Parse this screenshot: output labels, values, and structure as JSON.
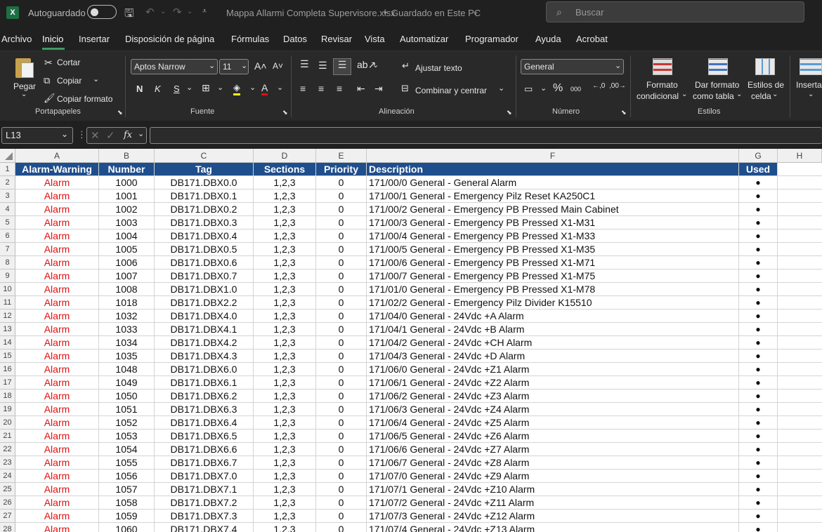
{
  "titlebar": {
    "autosave_label": "Autoguardado",
    "doc_title": "Mappa Allarmi Completa Supervisore.xlsx",
    "save_status": "Guardado en Este PC",
    "search_placeholder": "Buscar"
  },
  "menu": [
    "Archivo",
    "Inicio",
    "Insertar",
    "Disposición de página",
    "Fórmulas",
    "Datos",
    "Revisar",
    "Vista",
    "Automatizar",
    "Programador",
    "Ayuda",
    "Acrobat"
  ],
  "ribbon": {
    "clipboard": {
      "paste": "Pegar",
      "cut": "Cortar",
      "copy": "Copiar",
      "format_painter": "Copiar formato",
      "group": "Portapapeles"
    },
    "font": {
      "name": "Aptos Narrow",
      "size": "11",
      "bold": "N",
      "italic": "K",
      "underline": "S",
      "group": "Fuente"
    },
    "alignment": {
      "wrap": "Ajustar texto",
      "merge": "Combinar y centrar",
      "group": "Alineación"
    },
    "number": {
      "format": "General",
      "percent": "%",
      "thousands": "000",
      "group": "Número"
    },
    "styles": {
      "conditional": "Formato",
      "conditional2": "condicional",
      "as_table": "Dar formato",
      "as_table2": "como tabla",
      "cell_styles": "Estilos de",
      "cell_styles2": "celda",
      "group": "Estilos"
    },
    "cells": {
      "insert": "Inserta"
    }
  },
  "formula": {
    "name_box": "L13",
    "fx": "fx",
    "value": ""
  },
  "columns": [
    {
      "letter": "A"
    },
    {
      "letter": "B"
    },
    {
      "letter": "C"
    },
    {
      "letter": "D"
    },
    {
      "letter": "E"
    },
    {
      "letter": "F"
    },
    {
      "letter": "G"
    },
    {
      "letter": "H"
    }
  ],
  "table_header": [
    "Alarm-Warning",
    "Number",
    "Tag",
    "Sections",
    "Priority",
    "Description",
    "Used"
  ],
  "rows": [
    [
      "Alarm",
      "1000",
      "DB171.DBX0.0",
      "1,2,3",
      "0",
      "171/00/0 General - General Alarm",
      "●"
    ],
    [
      "Alarm",
      "1001",
      "DB171.DBX0.1",
      "1,2,3",
      "0",
      "171/00/1 General - Emergency Pilz Reset KA250C1",
      "●"
    ],
    [
      "Alarm",
      "1002",
      "DB171.DBX0.2",
      "1,2,3",
      "0",
      "171/00/2 General - Emergency PB Pressed Main Cabinet",
      "●"
    ],
    [
      "Alarm",
      "1003",
      "DB171.DBX0.3",
      "1,2,3",
      "0",
      "171/00/3 General - Emergency PB Pressed X1-M31",
      "●"
    ],
    [
      "Alarm",
      "1004",
      "DB171.DBX0.4",
      "1,2,3",
      "0",
      "171/00/4 General - Emergency PB Pressed X1-M33",
      "●"
    ],
    [
      "Alarm",
      "1005",
      "DB171.DBX0.5",
      "1,2,3",
      "0",
      "171/00/5 General - Emergency PB Pressed X1-M35",
      "●"
    ],
    [
      "Alarm",
      "1006",
      "DB171.DBX0.6",
      "1,2,3",
      "0",
      "171/00/6 General - Emergency PB Pressed X1-M71",
      "●"
    ],
    [
      "Alarm",
      "1007",
      "DB171.DBX0.7",
      "1,2,3",
      "0",
      "171/00/7 General - Emergency PB Pressed X1-M75",
      "●"
    ],
    [
      "Alarm",
      "1008",
      "DB171.DBX1.0",
      "1,2,3",
      "0",
      "171/01/0 General - Emergency PB Pressed X1-M78",
      "●"
    ],
    [
      "Alarm",
      "1018",
      "DB171.DBX2.2",
      "1,2,3",
      "0",
      "171/02/2 General - Emergency Pilz Divider K15510",
      "●"
    ],
    [
      "Alarm",
      "1032",
      "DB171.DBX4.0",
      "1,2,3",
      "0",
      "171/04/0 General - 24Vdc +A Alarm",
      "●"
    ],
    [
      "Alarm",
      "1033",
      "DB171.DBX4.1",
      "1,2,3",
      "0",
      "171/04/1 General - 24Vdc +B Alarm",
      "●"
    ],
    [
      "Alarm",
      "1034",
      "DB171.DBX4.2",
      "1,2,3",
      "0",
      "171/04/2 General - 24Vdc +CH Alarm",
      "●"
    ],
    [
      "Alarm",
      "1035",
      "DB171.DBX4.3",
      "1,2,3",
      "0",
      "171/04/3 General - 24Vdc +D Alarm",
      "●"
    ],
    [
      "Alarm",
      "1048",
      "DB171.DBX6.0",
      "1,2,3",
      "0",
      "171/06/0 General - 24Vdc +Z1 Alarm",
      "●"
    ],
    [
      "Alarm",
      "1049",
      "DB171.DBX6.1",
      "1,2,3",
      "0",
      "171/06/1 General - 24Vdc +Z2 Alarm",
      "●"
    ],
    [
      "Alarm",
      "1050",
      "DB171.DBX6.2",
      "1,2,3",
      "0",
      "171/06/2 General - 24Vdc +Z3 Alarm",
      "●"
    ],
    [
      "Alarm",
      "1051",
      "DB171.DBX6.3",
      "1,2,3",
      "0",
      "171/06/3 General - 24Vdc +Z4 Alarm",
      "●"
    ],
    [
      "Alarm",
      "1052",
      "DB171.DBX6.4",
      "1,2,3",
      "0",
      "171/06/4 General - 24Vdc +Z5 Alarm",
      "●"
    ],
    [
      "Alarm",
      "1053",
      "DB171.DBX6.5",
      "1,2,3",
      "0",
      "171/06/5 General - 24Vdc +Z6 Alarm",
      "●"
    ],
    [
      "Alarm",
      "1054",
      "DB171.DBX6.6",
      "1,2,3",
      "0",
      "171/06/6 General - 24Vdc +Z7 Alarm",
      "●"
    ],
    [
      "Alarm",
      "1055",
      "DB171.DBX6.7",
      "1,2,3",
      "0",
      "171/06/7 General - 24Vdc +Z8 Alarm",
      "●"
    ],
    [
      "Alarm",
      "1056",
      "DB171.DBX7.0",
      "1,2,3",
      "0",
      "171/07/0 General - 24Vdc +Z9 Alarm",
      "●"
    ],
    [
      "Alarm",
      "1057",
      "DB171.DBX7.1",
      "1,2,3",
      "0",
      "171/07/1 General - 24Vdc +Z10 Alarm",
      "●"
    ],
    [
      "Alarm",
      "1058",
      "DB171.DBX7.2",
      "1,2,3",
      "0",
      "171/07/2 General - 24Vdc +Z11 Alarm",
      "●"
    ],
    [
      "Alarm",
      "1059",
      "DB171.DBX7.3",
      "1,2,3",
      "0",
      "171/07/3 General - 24Vdc +Z12 Alarm",
      "●"
    ],
    [
      "Alarm",
      "1060",
      "DB171.DBX7.4",
      "1,2,3",
      "0",
      "171/07/4 General - 24Vdc +Z13 Alarm",
      "●"
    ]
  ],
  "colors": {
    "header_bg": "#1f4e8c",
    "alarm_text": "#e01010",
    "excel_green": "#1d6f42"
  }
}
